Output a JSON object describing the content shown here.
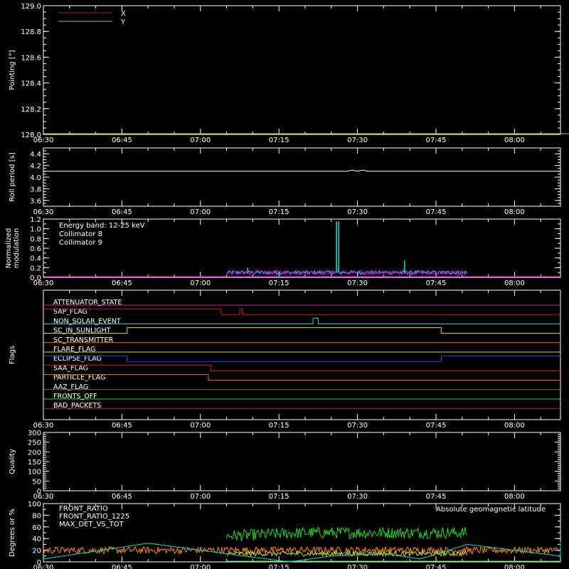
{
  "chart_data": [
    {
      "type": "line",
      "panel": "pointing",
      "ylabel": "Pointing [°]",
      "ylim": [
        128.0,
        129.0
      ],
      "yticks": [
        "128.0",
        "128.2",
        "128.4",
        "128.6",
        "128.8",
        "129.0"
      ],
      "x_tick_labels": [
        "06:30",
        "06:45",
        "07:00",
        "07:15",
        "07:30",
        "07:45",
        "08:00"
      ],
      "legend": [
        {
          "name": "X",
          "color": "#d01010"
        },
        {
          "name": "Y",
          "color": "#c8c800"
        }
      ],
      "series": [
        {
          "name": "Y",
          "color": "#c8c800",
          "x": [
            "06:30",
            "08:34"
          ],
          "values": [
            128.0,
            128.0
          ]
        }
      ]
    },
    {
      "type": "line",
      "panel": "roll",
      "ylabel": "Roll period [s]",
      "ylim": [
        3.5,
        4.5
      ],
      "yticks": [
        "3.6",
        "3.8",
        "4.0",
        "4.2",
        "4.4"
      ],
      "x_tick_labels": [
        "06:30",
        "06:45",
        "07:00",
        "07:15",
        "07:30",
        "07:45",
        "08:00"
      ],
      "series": [
        {
          "name": "",
          "color": "#ffffff",
          "x": [
            "06:30",
            "07:28",
            "07:29",
            "07:30",
            "07:31",
            "07:32",
            "08:34"
          ],
          "values": [
            4.1,
            4.1,
            4.12,
            4.1,
            4.12,
            4.1,
            4.1
          ]
        }
      ]
    },
    {
      "type": "line",
      "panel": "modulation",
      "ylabel": "Normalized modulation",
      "ylim": [
        0,
        1.2
      ],
      "yticks": [
        "0.0",
        "0.2",
        "0.4",
        "0.6",
        "0.8",
        "1.0",
        "1.2"
      ],
      "x_tick_labels": [
        "06:30",
        "06:45",
        "07:00",
        "07:15",
        "07:30",
        "07:45",
        "08:00"
      ],
      "legend": [
        {
          "name": "Energy band: 12-25 keV",
          "color": "#ffffff"
        },
        {
          "name": "Collimator 8",
          "color": "#00e5e5"
        },
        {
          "name": "Collimator 9",
          "color": "#e000e0"
        }
      ],
      "series": [
        {
          "name": "Collimator 8",
          "color": "#00e5e5",
          "x_start": "07:05",
          "x_end": "07:51",
          "baseline": 0.1,
          "spikes": [
            {
              "x": "07:26",
              "y": 1.15
            },
            {
              "x": "07:26.4",
              "y": 1.15
            },
            {
              "x": "07:39",
              "y": 0.35
            },
            {
              "x": "07:09",
              "y": 0.2
            }
          ]
        },
        {
          "name": "Collimator 9",
          "color": "#e000e0",
          "x_start": "07:05",
          "x_end": "07:51",
          "baseline": 0.1
        }
      ]
    },
    {
      "type": "line",
      "panel": "flags",
      "ylabel": "Flags",
      "x_tick_labels": [
        "06:30",
        "06:45",
        "07:00",
        "07:15",
        "07:30",
        "07:45",
        "08:00"
      ],
      "flags": [
        {
          "label": "ATTENUATOR_STATE",
          "color": "#c020c0",
          "steps": []
        },
        {
          "label": "SAP_FLAG",
          "color": "#e01010",
          "steps": [
            [
              "07:04",
              "07:07.5",
              0
            ],
            [
              "07:07.5",
              "07:08",
              1
            ],
            [
              "07:08",
              "08:34",
              0
            ]
          ],
          "initial": 1
        },
        {
          "label": "NON_SOLAR_EVENT",
          "color": "#00e0e0",
          "steps": [
            [
              "07:21.5",
              "07:22.5",
              1
            ]
          ]
        },
        {
          "label": "SC_IN_SUNLIGHT",
          "color": "#e0e000",
          "steps": [
            [
              "06:46",
              "07:46",
              1
            ]
          ]
        },
        {
          "label": "SC_TRANSMITTER",
          "color": "#ff6a00",
          "steps": []
        },
        {
          "label": "FLARE_FLAG",
          "color": "#e0e000",
          "steps": []
        },
        {
          "label": "ECLIPSE_FLAG",
          "color": "#2040ff",
          "steps": [
            [
              "06:30",
              "06:46",
              1
            ],
            [
              "07:46",
              "08:34",
              1
            ]
          ]
        },
        {
          "label": "SAA_FLAG",
          "color": "#e01010",
          "steps": [
            [
              "06:30",
              "07:02",
              1
            ]
          ]
        },
        {
          "label": "PARTICLE_FLAG",
          "color": "#ff6a00",
          "steps": [
            [
              "06:30",
              "07:01.5",
              1
            ]
          ]
        },
        {
          "label": "AAZ_FLAG",
          "color": "#808000",
          "steps": []
        },
        {
          "label": "FRONTS_OFF",
          "color": "#20e020",
          "steps": []
        },
        {
          "label": "BAD_PACKETS",
          "color": "#e01010",
          "steps": []
        }
      ]
    },
    {
      "type": "line",
      "panel": "quality",
      "ylabel": "Quality",
      "ylim": [
        0,
        300
      ],
      "yticks": [
        "0",
        "50",
        "100",
        "150",
        "200",
        "250",
        "300"
      ],
      "x_tick_labels": [
        "06:30",
        "06:45",
        "07:00",
        "07:15",
        "07:30",
        "07:45",
        "08:00"
      ],
      "series": []
    },
    {
      "type": "line",
      "panel": "ratios",
      "ylabel": "Degrees or %",
      "ylim": [
        0,
        100
      ],
      "yticks": [
        "0",
        "20",
        "40",
        "60",
        "80",
        "100"
      ],
      "x_tick_labels": [
        "06:30",
        "06:45",
        "07:00",
        "07:15",
        "07:30",
        "07:45",
        "08:00"
      ],
      "legend": [
        {
          "name": "FRONT_RATIO",
          "color": "#e0e000"
        },
        {
          "name": "FRONT_RATIO_1225",
          "color": "#20e020"
        },
        {
          "name": "MAX_DET_VS_TOT",
          "color": "#ff8c00"
        }
      ],
      "annotation": {
        "text": "Absolute geomagnetic latitude",
        "color": "#00e0e0"
      },
      "series": [
        {
          "name": "FRONT_RATIO_1225",
          "color": "#20e020",
          "x_start": "07:05",
          "x_end": "07:51",
          "mean": 50,
          "spread": 10
        },
        {
          "name": "MAX_DET_VS_TOT",
          "color": "#ff8c00",
          "x_start": "06:30",
          "x_end": "08:34",
          "mean": 20,
          "spread": 6
        },
        {
          "name": "FRONT_RATIO",
          "color": "#e0e000",
          "x_start": "07:05",
          "x_end": "07:51",
          "mean": 14,
          "spread": 4
        },
        {
          "name": "Absolute geomagnetic latitude",
          "color": "#00e0e0",
          "x": [
            "06:30",
            "06:50",
            "07:10",
            "07:17",
            "07:25",
            "07:35",
            "07:42",
            "07:51",
            "08:10",
            "08:34"
          ],
          "values": [
            5,
            32,
            8,
            0,
            10,
            14,
            5,
            30,
            10,
            35
          ]
        }
      ]
    }
  ]
}
